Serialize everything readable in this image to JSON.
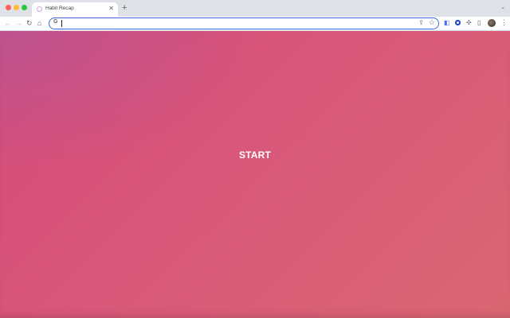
{
  "browser": {
    "tab": {
      "title": "Habit Recap",
      "close_glyph": "✕",
      "favicon": "habit-recap-icon"
    },
    "new_tab_glyph": "+",
    "tabstrip_chevron_glyph": "⌄",
    "toolbar": {
      "back_glyph": "←",
      "forward_glyph": "→",
      "reload_glyph": "↻",
      "home_glyph": "⌂",
      "menu_glyph": "⋮"
    },
    "omnibox": {
      "value": "",
      "placeholder": "",
      "search_engine_glyph": "G",
      "share_glyph": "⇪",
      "bookmark_glyph": "☆"
    },
    "extensions": {
      "ext_1_glyph": "◧",
      "puzzle_glyph": "✣",
      "sidebar_glyph": "▯"
    }
  },
  "page": {
    "start_label": "START"
  },
  "colors": {
    "background_start": "#d64a7a",
    "background_end": "#da6672",
    "accent_blue": "#3f6ad8"
  }
}
